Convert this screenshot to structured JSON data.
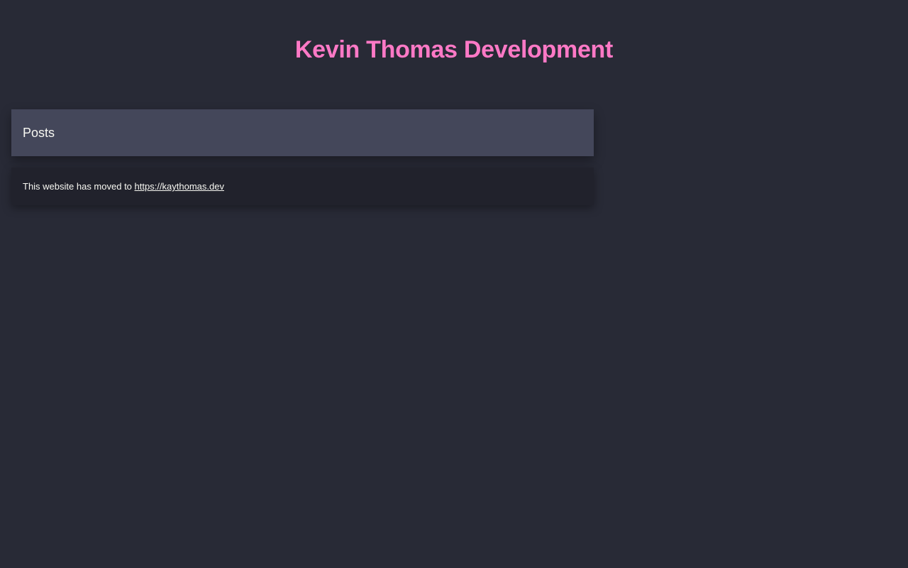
{
  "site": {
    "title": "Kevin Thomas Development",
    "accent_color": "#ff79c6",
    "background_color": "#282a36"
  },
  "posts_section": {
    "title": "Posts"
  },
  "notice": {
    "text": "This website has moved to ",
    "link_label": "https://kaythomas.dev"
  }
}
